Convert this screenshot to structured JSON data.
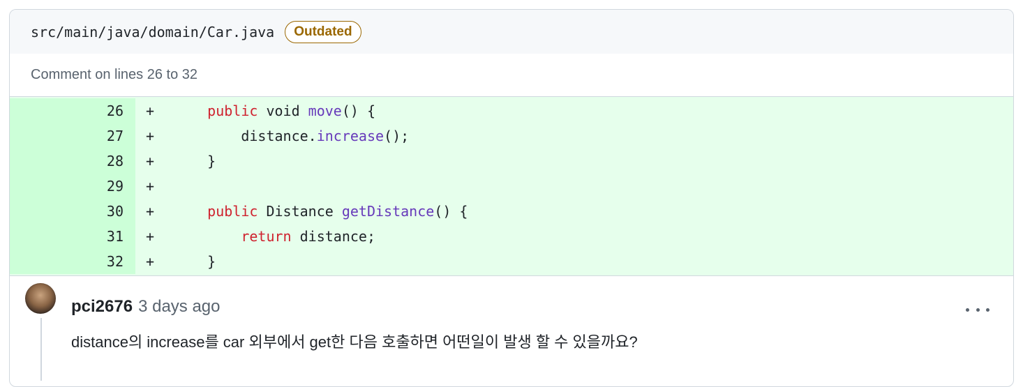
{
  "file": {
    "path": "src/main/java/domain/Car.java",
    "badge": "Outdated"
  },
  "comment_range": "Comment on lines 26 to 32",
  "diff": {
    "lines": [
      {
        "no": "26",
        "sign": "+",
        "tokens": [
          {
            "t": "    ",
            "c": "plain"
          },
          {
            "t": "public",
            "c": "keyword"
          },
          {
            "t": " void ",
            "c": "plain"
          },
          {
            "t": "move",
            "c": "func"
          },
          {
            "t": "() {",
            "c": "plain"
          }
        ]
      },
      {
        "no": "27",
        "sign": "+",
        "tokens": [
          {
            "t": "        distance.",
            "c": "plain"
          },
          {
            "t": "increase",
            "c": "func"
          },
          {
            "t": "();",
            "c": "plain"
          }
        ]
      },
      {
        "no": "28",
        "sign": "+",
        "tokens": [
          {
            "t": "    }",
            "c": "plain"
          }
        ]
      },
      {
        "no": "29",
        "sign": "+",
        "tokens": []
      },
      {
        "no": "30",
        "sign": "+",
        "tokens": [
          {
            "t": "    ",
            "c": "plain"
          },
          {
            "t": "public",
            "c": "keyword"
          },
          {
            "t": " Distance ",
            "c": "plain"
          },
          {
            "t": "getDistance",
            "c": "func"
          },
          {
            "t": "() {",
            "c": "plain"
          }
        ]
      },
      {
        "no": "31",
        "sign": "+",
        "tokens": [
          {
            "t": "        ",
            "c": "plain"
          },
          {
            "t": "return",
            "c": "keyword"
          },
          {
            "t": " distance;",
            "c": "plain"
          }
        ]
      },
      {
        "no": "32",
        "sign": "+",
        "tokens": [
          {
            "t": "    }",
            "c": "plain"
          }
        ]
      }
    ]
  },
  "comment": {
    "author": "pci2676",
    "timestamp": "3 days ago",
    "body": "distance의 increase를 car 외부에서 get한 다음 호출하면 어떤일이 발생 할 수 있을까요?",
    "avatar_icon": "user-avatar",
    "menu_icon": "kebab-horizontal-icon"
  },
  "colors": {
    "added_bg": "#e6ffec",
    "added_gutter_bg": "#ccffd8",
    "keyword": "#cf222e",
    "function": "#6639ba",
    "badge": "#9a6700"
  }
}
